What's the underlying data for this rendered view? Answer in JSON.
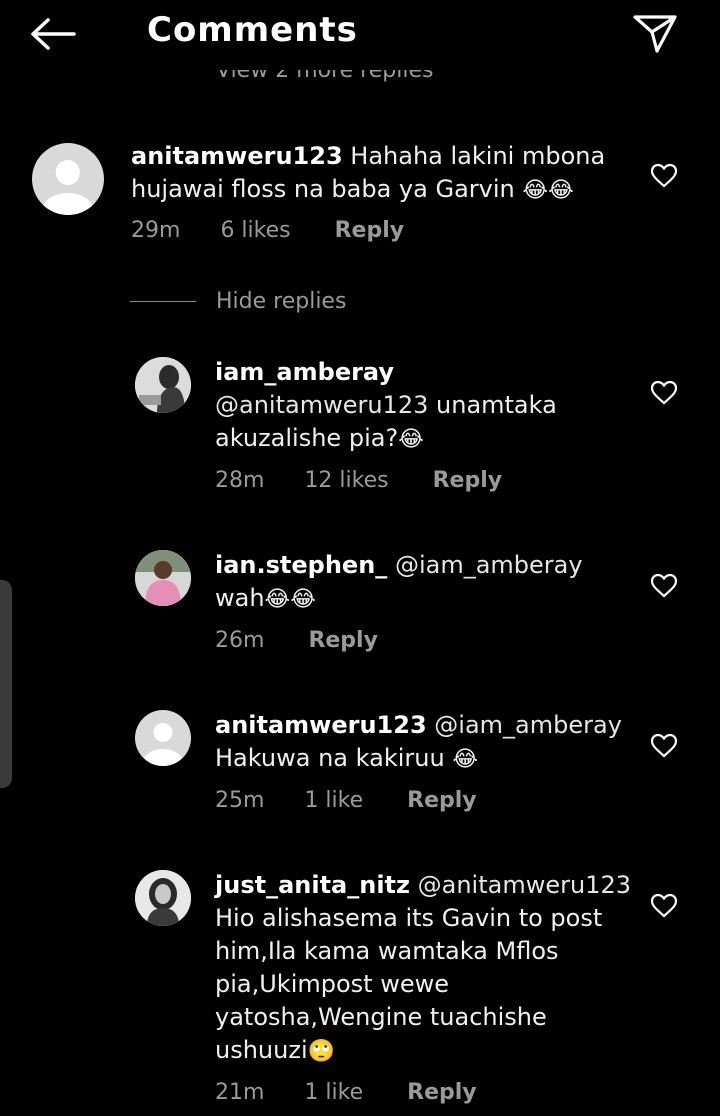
{
  "header": {
    "title": "Comments",
    "back_icon": "back-arrow-icon",
    "send_icon": "send-icon"
  },
  "view_more_replies": "View 2 more replies",
  "hide_replies": "Hide replies",
  "comments": [
    {
      "username": "anitamweru123",
      "text": "Hahaha lakini mbona hujawai floss na baba ya Garvin",
      "emoji": "😂😂",
      "time": "29m",
      "likes": "6 likes",
      "reply": "Reply",
      "avatar": "placeholder"
    },
    {
      "username": "iam_amberay",
      "mention": "@anitamweru123",
      "text": "unamtaka akuzalishe pia?",
      "emoji": "😂",
      "time": "28m",
      "likes": "12 likes",
      "reply": "Reply",
      "avatar": "photo"
    },
    {
      "username": "ian.stephen_",
      "mention": "@iam_amberay",
      "text": "wah",
      "emoji": "😂😂",
      "time": "26m",
      "reply": "Reply",
      "avatar": "photo"
    },
    {
      "username": "anitamweru123",
      "mention": "@iam_amberay",
      "text": "Hakuwa na kakiruu",
      "emoji": "😂",
      "time": "25m",
      "likes": "1 like",
      "reply": "Reply",
      "avatar": "placeholder"
    },
    {
      "username": "just_anita_nitz",
      "mention": "@anitamweru123",
      "text": "Hio alishasema its Gavin to post him,Ila kama wamtaka Mflos pia,Ukimpost wewe yatosha,Wengine tuachishe ushuuzi",
      "emoji": "🙄",
      "time": "21m",
      "likes": "1 like",
      "reply": "Reply",
      "avatar": "photo"
    }
  ],
  "colors": {
    "background": "#000000",
    "text": "#f2f2f2",
    "secondary_text": "#9a9a9a"
  }
}
